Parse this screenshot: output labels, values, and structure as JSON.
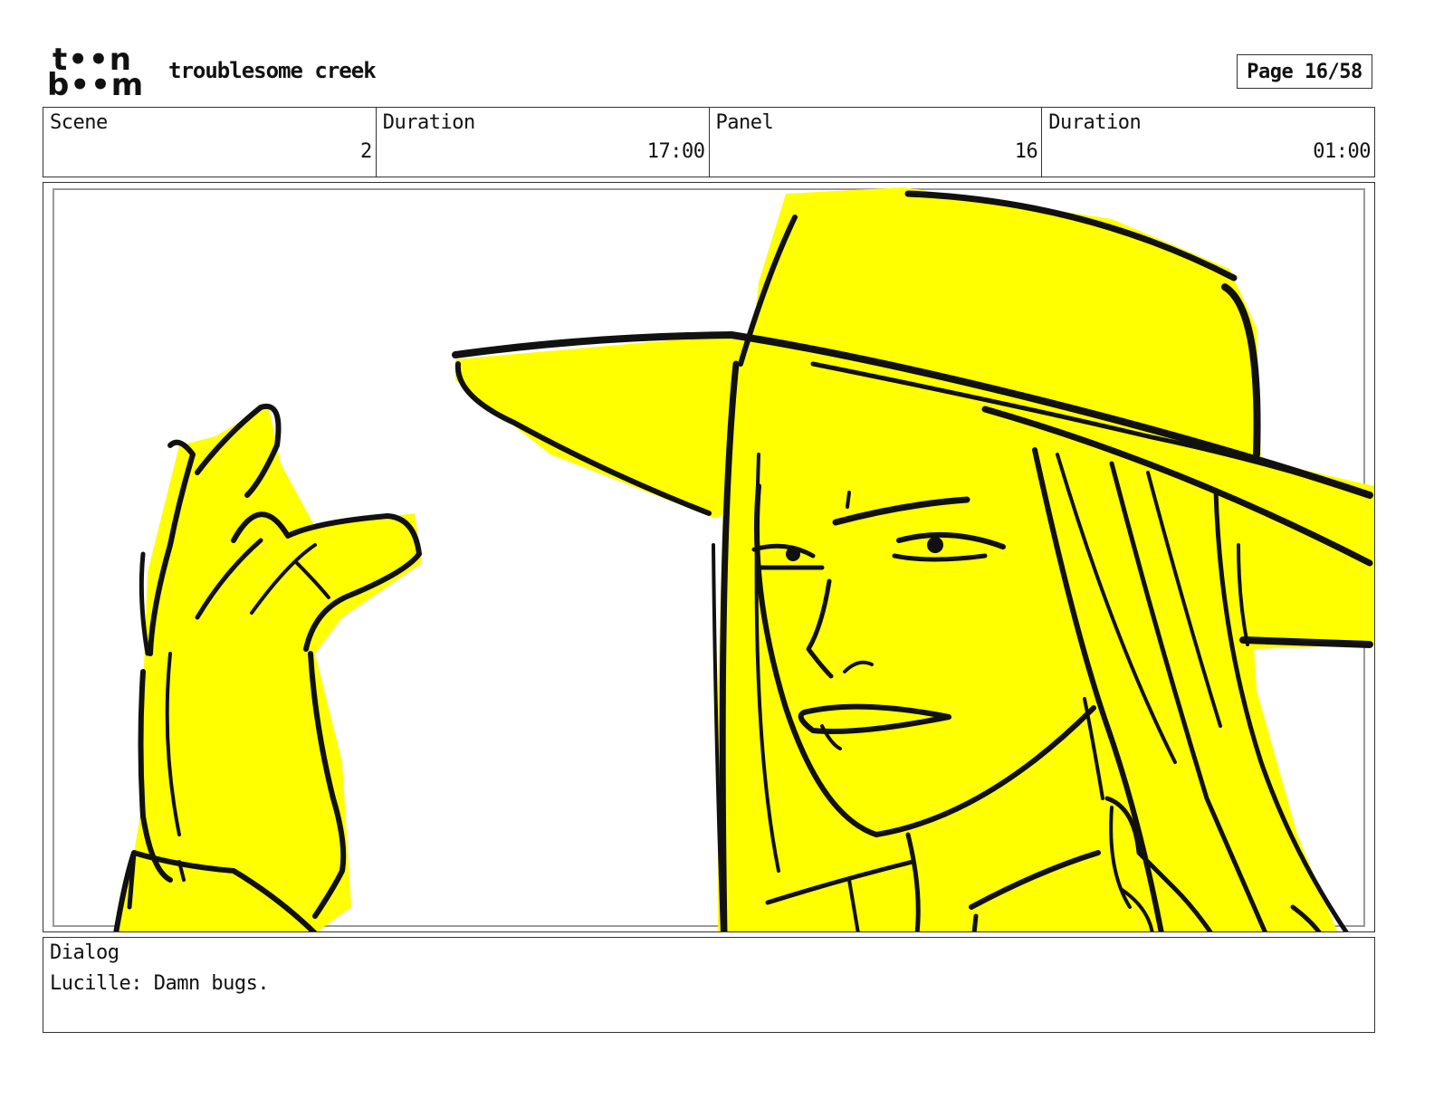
{
  "header": {
    "logo": {
      "line1": "t••n",
      "line2": "b••m",
      "icon": "toon-boom-logo"
    },
    "project_title": "troublesome creek",
    "page_label": "Page 16/58"
  },
  "info": {
    "scene_label": "Scene",
    "scene_value": "2",
    "scene_duration_label": "Duration",
    "scene_duration_value": "17:00",
    "panel_label": "Panel",
    "panel_value": "16",
    "panel_duration_label": "Duration",
    "panel_duration_value": "01:00"
  },
  "panel": {
    "drawing": "storyboard-sketch",
    "colors": {
      "fill": "#ffff00",
      "line": "#111111",
      "safe_frame": "#9a9a9a"
    }
  },
  "dialog": {
    "label": "Dialog",
    "text": "Lucille: Damn bugs."
  }
}
